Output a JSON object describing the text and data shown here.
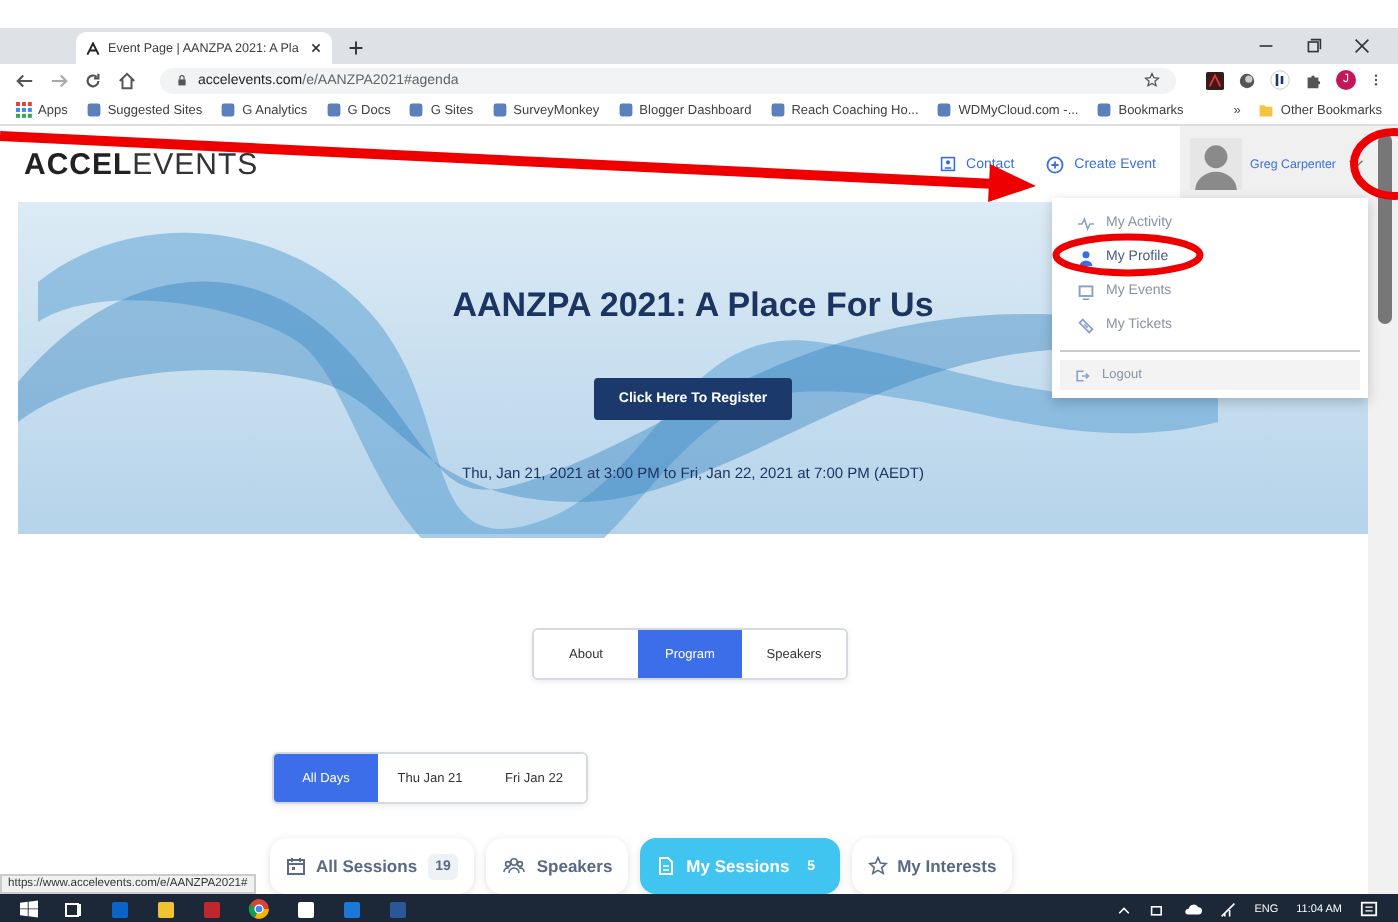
{
  "browser": {
    "tab_title": "Event Page | AANZPA 2021: A Pla",
    "url_host": "accelevents.com",
    "url_path": "/e/AANZPA2021#agenda",
    "profile_initial": "J",
    "bookmarks": [
      {
        "label": "Apps"
      },
      {
        "label": "Suggested Sites"
      },
      {
        "label": "G Analytics"
      },
      {
        "label": "G Docs"
      },
      {
        "label": "G Sites"
      },
      {
        "label": "SurveyMonkey"
      },
      {
        "label": "Blogger Dashboard"
      },
      {
        "label": "Reach Coaching Ho..."
      },
      {
        "label": "WDMyCloud.com -..."
      },
      {
        "label": "Bookmarks"
      }
    ],
    "bookmarks_overflow": "»",
    "other_bookmarks": "Other Bookmarks"
  },
  "header": {
    "logo": "**ACCEL**EVENTS",
    "links": [
      {
        "label": "Contact",
        "kind": "contact"
      },
      {
        "label": "Create Event",
        "kind": "create"
      }
    ],
    "user_name": "Greg Carpenter"
  },
  "user_menu": {
    "items": [
      {
        "label": "My Activity",
        "kind": "activity"
      },
      {
        "label": "My Profile",
        "kind": "profile"
      },
      {
        "label": "My Events",
        "kind": "events"
      },
      {
        "label": "My Tickets",
        "kind": "tickets"
      }
    ],
    "logout": "Logout"
  },
  "hero": {
    "title": "AANZPA 2021: A Place For Us",
    "register_button": "Click Here To Register",
    "date_range": "Thu, Jan 21, 2021 at 3:00 PM to Fri, Jan 22, 2021 at 7:00 PM (AEDT)"
  },
  "section_tabs": [
    {
      "label": "About",
      "selected": false
    },
    {
      "label": "Program",
      "selected": true
    },
    {
      "label": "Speakers",
      "selected": false
    }
  ],
  "day_tabs": [
    {
      "label": "All Days",
      "selected": true
    },
    {
      "label": "Thu Jan 21",
      "selected": false
    },
    {
      "label": "Fri Jan 22",
      "selected": false
    }
  ],
  "session_tabs": [
    {
      "label": "All Sessions",
      "count": "19",
      "kind": "calendar",
      "selected": false
    },
    {
      "label": "Speakers",
      "kind": "people",
      "selected": false
    },
    {
      "label": "My Sessions",
      "count": "5",
      "kind": "document",
      "selected": true
    },
    {
      "label": "My Interests",
      "kind": "star",
      "selected": false
    }
  ],
  "status_url": "https://www.accelevents.com/e/AANZPA2021#",
  "taskbar": {
    "language": "ENG",
    "time": "11:04 AM"
  }
}
